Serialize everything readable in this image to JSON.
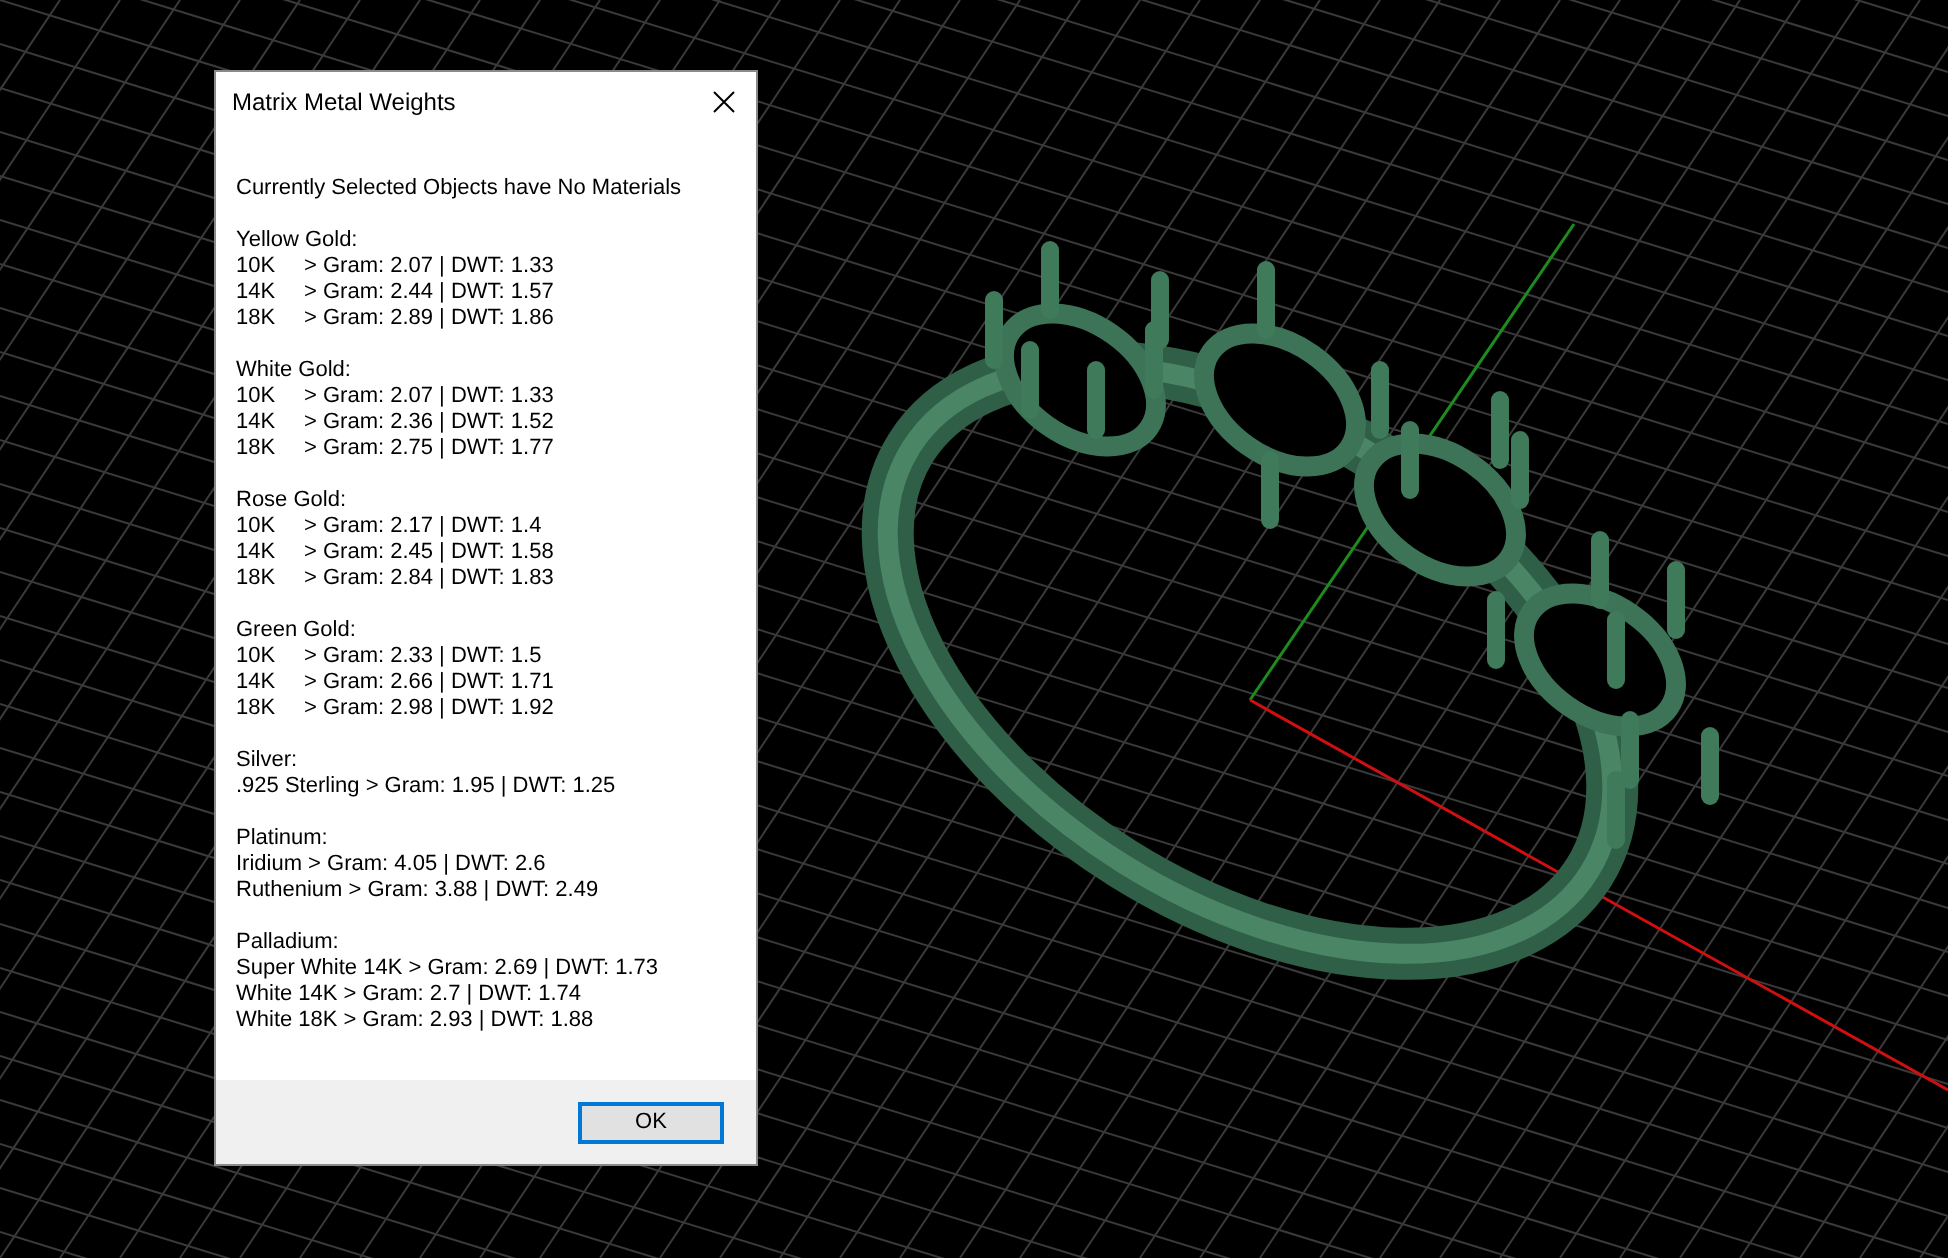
{
  "dialog": {
    "title": "Matrix Metal Weights",
    "message": "Currently Selected Objects have No Materials",
    "groups": [
      {
        "name": "Yellow Gold:",
        "kind": "graded",
        "rows": [
          {
            "grade": "10K",
            "reading": "> Gram: 2.07 | DWT: 1.33"
          },
          {
            "grade": "14K",
            "reading": "> Gram: 2.44 | DWT: 1.57"
          },
          {
            "grade": "18K",
            "reading": "> Gram: 2.89 | DWT: 1.86"
          }
        ]
      },
      {
        "name": "White Gold:",
        "kind": "graded",
        "rows": [
          {
            "grade": "10K",
            "reading": "> Gram: 2.07 | DWT: 1.33"
          },
          {
            "grade": "14K",
            "reading": "> Gram: 2.36 | DWT: 1.52"
          },
          {
            "grade": "18K",
            "reading": "> Gram: 2.75 | DWT: 1.77"
          }
        ]
      },
      {
        "name": "Rose Gold:",
        "kind": "graded",
        "rows": [
          {
            "grade": "10K",
            "reading": "> Gram: 2.17 | DWT: 1.4"
          },
          {
            "grade": "14K",
            "reading": "> Gram: 2.45 | DWT: 1.58"
          },
          {
            "grade": "18K",
            "reading": "> Gram: 2.84 | DWT: 1.83"
          }
        ]
      },
      {
        "name": "Green Gold:",
        "kind": "graded",
        "rows": [
          {
            "grade": "10K",
            "reading": "> Gram: 2.33 | DWT: 1.5"
          },
          {
            "grade": "14K",
            "reading": "> Gram: 2.66 | DWT: 1.71"
          },
          {
            "grade": "18K",
            "reading": "> Gram: 2.98 | DWT: 1.92"
          }
        ]
      },
      {
        "name": "Silver:",
        "kind": "plain",
        "lines": [
          ".925 Sterling > Gram: 1.95 | DWT: 1.25"
        ]
      },
      {
        "name": "Platinum:",
        "kind": "plain",
        "lines": [
          "Iridium > Gram: 4.05 | DWT: 2.6",
          "Ruthenium > Gram: 3.88 | DWT: 2.49"
        ]
      },
      {
        "name": "Palladium:",
        "kind": "plain",
        "lines": [
          "Super White 14K > Gram: 2.69 | DWT: 1.73",
          "White 14K > Gram: 2.7 | DWT: 1.74",
          "White 18K > Gram: 2.93 | DWT: 1.88"
        ]
      }
    ],
    "buttons": [
      "OK"
    ]
  }
}
